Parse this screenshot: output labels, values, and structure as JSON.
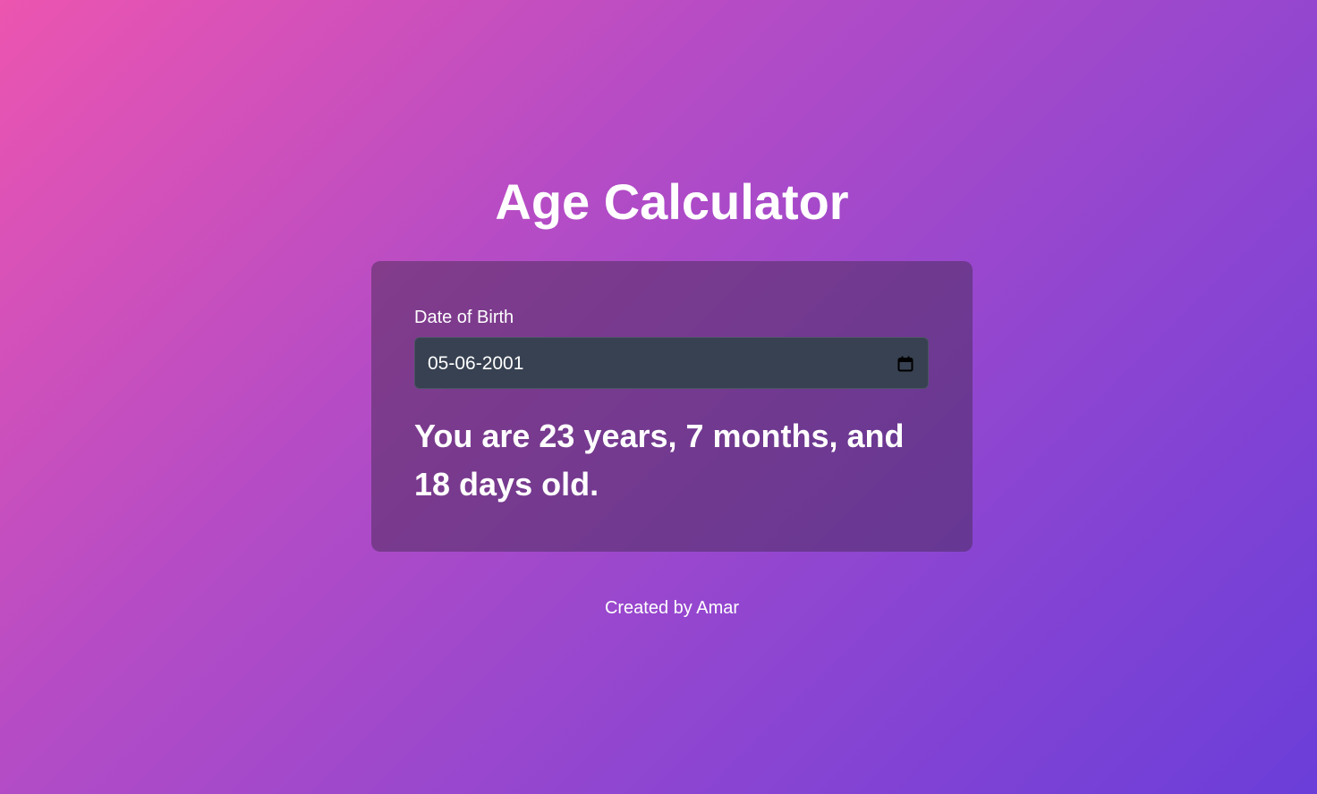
{
  "app": {
    "title": "Age Calculator"
  },
  "form": {
    "dob_label": "Date of Birth",
    "dob_value": "05-06-2001",
    "calendar_icon": "calendar-icon"
  },
  "result": {
    "text": "You are 23 years, 7 months, and 18 days old."
  },
  "footer": {
    "text": "Created by Amar"
  },
  "colors": {
    "gradient_start": "#ec55b0",
    "gradient_end": "#6b3ed9",
    "input_background": "#374151",
    "text": "#ffffff"
  }
}
